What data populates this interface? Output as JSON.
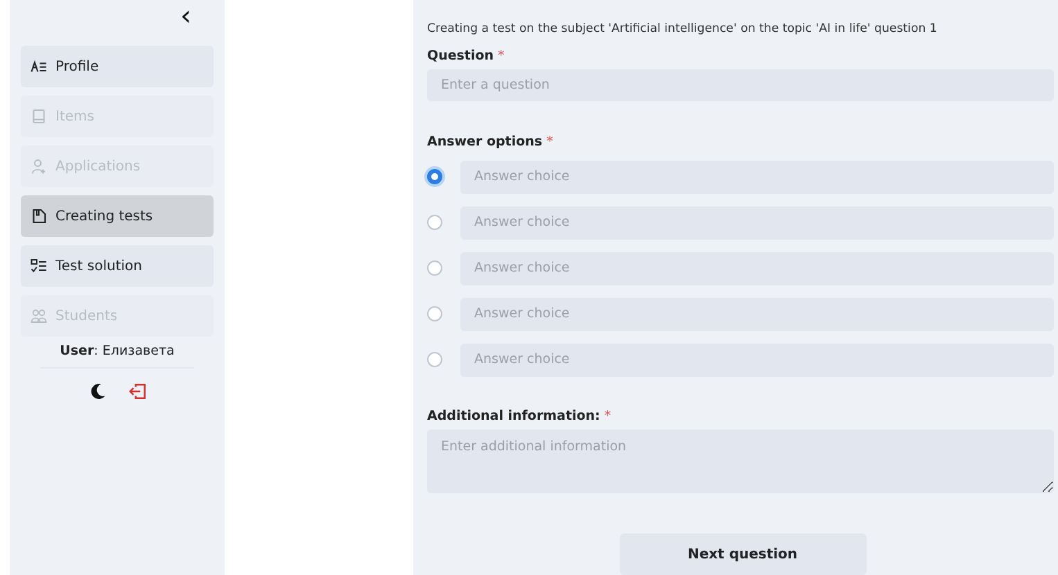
{
  "sidebar": {
    "collapse_icon": "‹",
    "items": [
      {
        "label": "Profile",
        "kind": "profile",
        "selected": false,
        "disabled": false
      },
      {
        "label": "Items",
        "kind": "book",
        "selected": false,
        "disabled": true
      },
      {
        "label": "Applications",
        "kind": "user-plus",
        "selected": false,
        "disabled": true
      },
      {
        "label": "Creating tests",
        "kind": "file",
        "selected": true,
        "disabled": false
      },
      {
        "label": "Test solution",
        "kind": "checklist",
        "selected": false,
        "disabled": false
      },
      {
        "label": "Students",
        "kind": "users",
        "selected": false,
        "disabled": true
      }
    ],
    "user": {
      "label": "User",
      "name": ": Елизавета"
    }
  },
  "form": {
    "heading": "Creating a test on the subject 'Artificial intelligence' on the topic 'AI in life' question 1",
    "question": {
      "label": "Question",
      "mark": "*",
      "placeholder": "Enter a question"
    },
    "answers": {
      "label": "Answer options",
      "mark": "*",
      "options": [
        {
          "placeholder": "Answer choice",
          "selected": true
        },
        {
          "placeholder": "Answer choice",
          "selected": false
        },
        {
          "placeholder": "Answer choice",
          "selected": false
        },
        {
          "placeholder": "Answer choice",
          "selected": false
        },
        {
          "placeholder": "Answer choice",
          "selected": false
        }
      ]
    },
    "additional": {
      "label": "Additional information:",
      "mark": "*",
      "placeholder": "Enter additional information"
    },
    "next_button": "Next question"
  }
}
